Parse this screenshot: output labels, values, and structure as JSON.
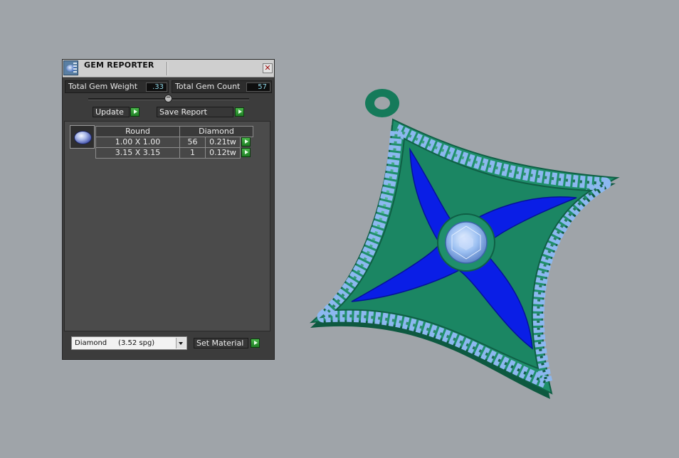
{
  "window": {
    "title": "GEM REPORTER",
    "close_label": "✕"
  },
  "stats": {
    "weight_label": "Total Gem Weight",
    "weight_value": ".33",
    "count_label": "Total Gem Count",
    "count_value": "57"
  },
  "toolbar": {
    "update_label": "Update",
    "save_report_label": "Save Report"
  },
  "table": {
    "headers": [
      "Round",
      "Diamond"
    ],
    "rows": [
      {
        "size": "1.00 X 1.00",
        "count": "56",
        "weight": "0.21tw"
      },
      {
        "size": "3.15 X 3.15",
        "count": "1",
        "weight": "0.12tw"
      }
    ]
  },
  "material": {
    "selected": "Diamond     (3.52 spg)",
    "set_label": "Set Material"
  },
  "colors": {
    "pendant_metal": "#1f8f6b",
    "pendant_enamel": "#0a1ee6",
    "pendant_stones": "#8cb8f0",
    "viewport_bg": "#9fa4a9",
    "go_button": "#2f9a33"
  },
  "icons": {
    "app": "gem-reporter-icon",
    "close": "close-icon",
    "go": "play-arrow-icon",
    "gem": "round-gem-icon",
    "dropdown": "chevron-down-icon"
  }
}
